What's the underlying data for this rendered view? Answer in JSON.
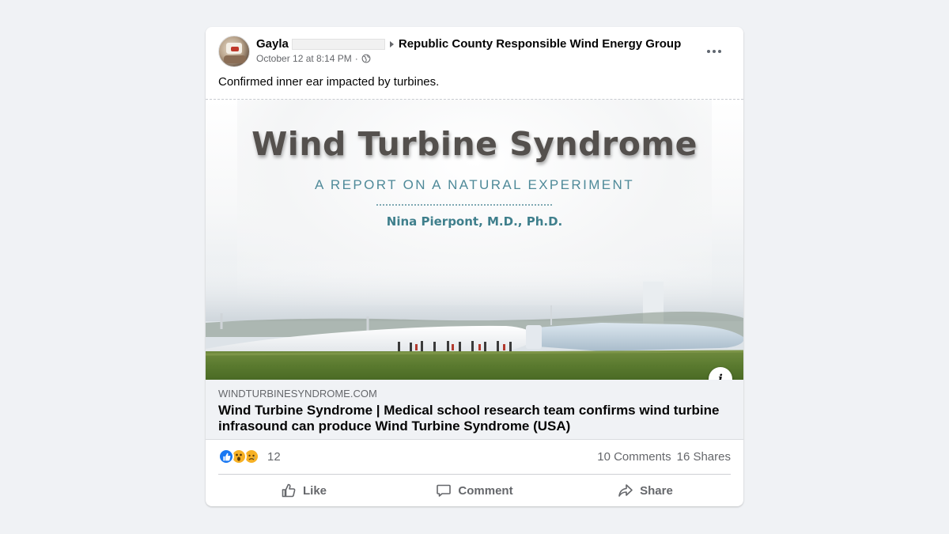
{
  "post": {
    "author_name": "Gayla",
    "group_name": "Republic County Responsible Wind Energy Group",
    "timestamp": "October 12 at 8:14 PM",
    "separator": "·",
    "privacy_icon": "globe-icon",
    "text": "Confirmed inner ear impacted by turbines."
  },
  "link_preview": {
    "image": {
      "title": "Wind Turbine Syndrome",
      "subtitle": "A REPORT ON A NATURAL EXPERIMENT",
      "author": "Nina Pierpont, M.D., Ph.D."
    },
    "info_icon": "i",
    "domain": "WINDTURBINESYNDROME.COM",
    "title": "Wind Turbine Syndrome | Medical school research team confirms wind turbine infrasound can produce Wind Turbine Syndrome (USA)"
  },
  "engagement": {
    "reaction_icons": [
      "like-icon",
      "wow-icon",
      "sad-icon"
    ],
    "reaction_count": "12",
    "comments": "10 Comments",
    "shares": "16 Shares"
  },
  "actions": {
    "like": "Like",
    "comment": "Comment",
    "share": "Share"
  },
  "colors": {
    "background": "#f0f2f5",
    "like_blue": "#1877f2",
    "secondary_text": "#65676b",
    "image_title": "#54504d",
    "image_teal": "#4f8a99"
  }
}
